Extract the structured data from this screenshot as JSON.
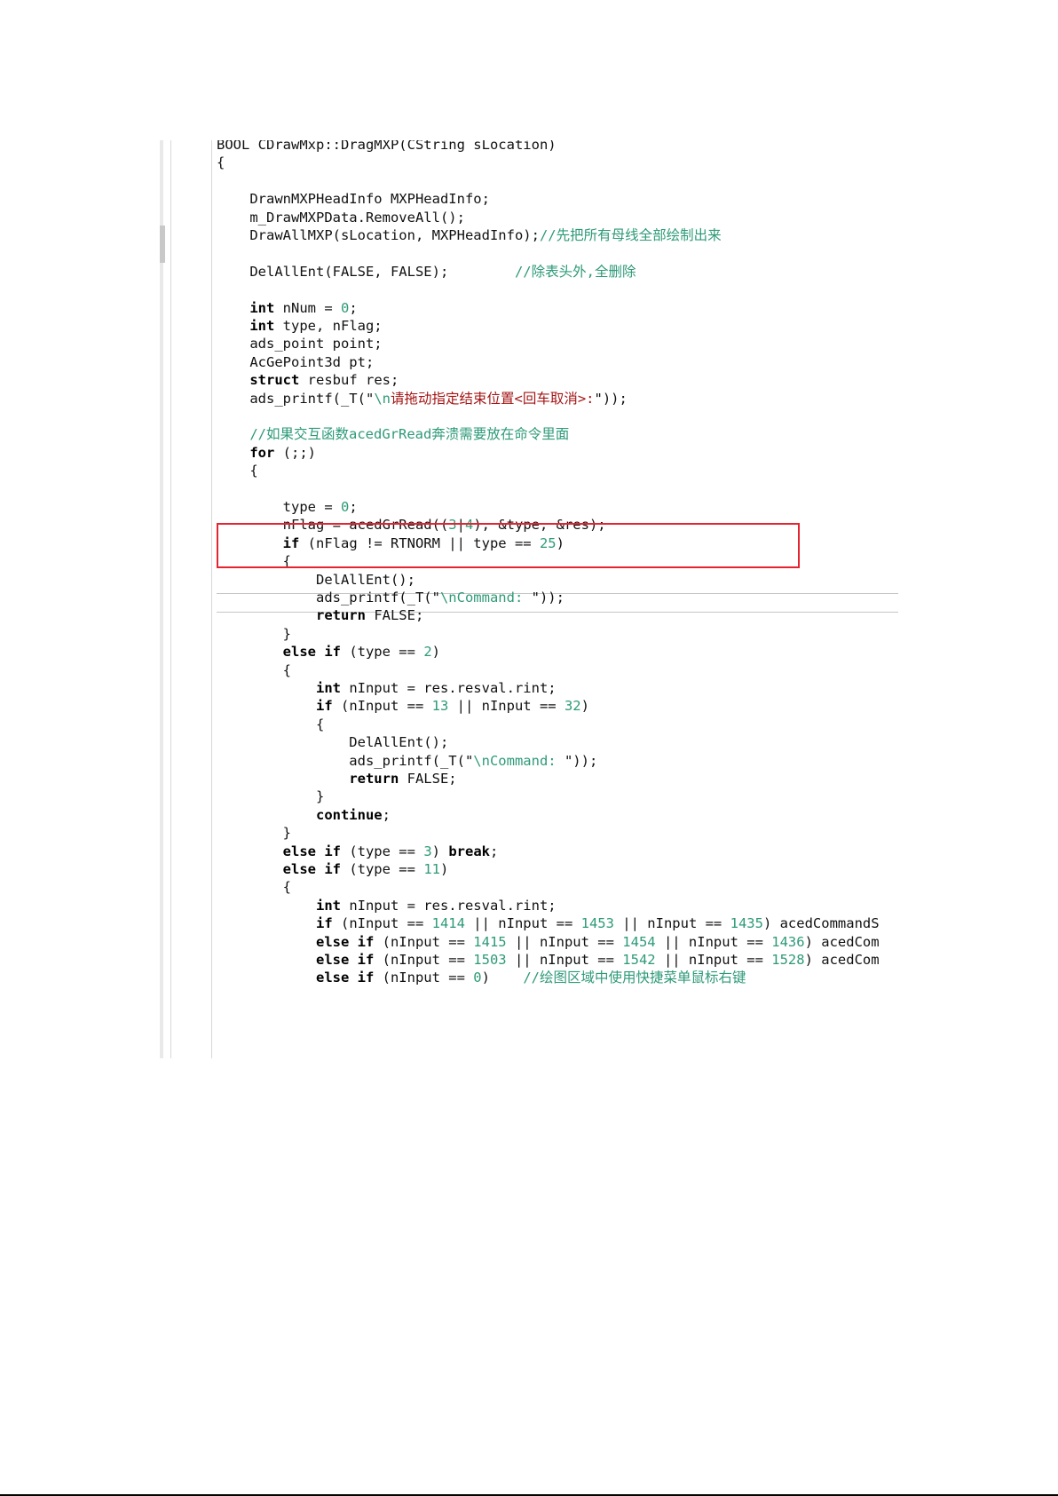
{
  "editor": {
    "lines": [
      [
        [
          "BOOL CDrawMxp::DragMXP(CString sLocation)",
          ""
        ]
      ],
      [
        [
          "{",
          ""
        ]
      ],
      [],
      [
        [
          "    DrawnMXPHeadInfo MXPHeadInfo;",
          ""
        ]
      ],
      [
        [
          "    m_DrawMXPData.RemoveAll();",
          ""
        ]
      ],
      [
        [
          "    DrawAllMXP(sLocation, MXPHeadInfo);",
          ""
        ],
        [
          "//先把所有母线全部绘制出来",
          "cmt"
        ]
      ],
      [],
      [
        [
          "    DelAllEnt(FALSE, FALSE);        ",
          ""
        ],
        [
          "//除表头外,全删除",
          "cmt"
        ]
      ],
      [],
      [
        [
          "    ",
          ""
        ],
        [
          "int",
          "kw"
        ],
        [
          " nNum = ",
          ""
        ],
        [
          "0",
          "num"
        ],
        [
          ";",
          ""
        ]
      ],
      [
        [
          "    ",
          ""
        ],
        [
          "int",
          "kw"
        ],
        [
          " type, nFlag;",
          ""
        ]
      ],
      [
        [
          "    ads_point point;",
          ""
        ]
      ],
      [
        [
          "    AcGePoint3d pt;",
          ""
        ]
      ],
      [
        [
          "    ",
          ""
        ],
        [
          "struct",
          "kw"
        ],
        [
          " resbuf res;",
          ""
        ]
      ],
      [
        [
          "    ads_printf(_T(\"",
          ""
        ],
        [
          "\\n",
          "esc"
        ],
        [
          "请拖动指定结束位置<回车取消>:",
          "str"
        ],
        [
          "\"));",
          ""
        ]
      ],
      [],
      [
        [
          "    ",
          ""
        ],
        [
          "//如果交互函数acedGrRead奔溃需要放在命令里面",
          "cmt"
        ]
      ],
      [
        [
          "    ",
          ""
        ],
        [
          "for",
          "kw"
        ],
        [
          " (;;)",
          ""
        ]
      ],
      [
        [
          "    {",
          ""
        ]
      ],
      [],
      [
        [
          "        type = ",
          ""
        ],
        [
          "0",
          "num"
        ],
        [
          ";",
          ""
        ]
      ],
      [
        [
          "        nFlag = acedGrRead((",
          ""
        ],
        [
          "3",
          "num"
        ],
        [
          "|",
          ""
        ],
        [
          "4",
          "num"
        ],
        [
          "), &type, &res);",
          ""
        ]
      ],
      [
        [
          "        ",
          ""
        ],
        [
          "if",
          "kw"
        ],
        [
          " (nFlag != RTNORM || type == ",
          ""
        ],
        [
          "25",
          "num"
        ],
        [
          ")",
          ""
        ]
      ],
      [
        [
          "        {",
          ""
        ]
      ],
      [
        [
          "            DelAllEnt();",
          ""
        ]
      ],
      [
        [
          "            ads_printf(_T(\"",
          ""
        ],
        [
          "\\nCommand: ",
          "esc"
        ],
        [
          "\"));",
          ""
        ]
      ],
      [
        [
          "            ",
          ""
        ],
        [
          "return",
          "kw"
        ],
        [
          " FALSE;",
          ""
        ]
      ],
      [
        [
          "        }",
          ""
        ]
      ],
      [
        [
          "        ",
          ""
        ],
        [
          "else if",
          "kw"
        ],
        [
          " (type == ",
          ""
        ],
        [
          "2",
          "num"
        ],
        [
          ")",
          ""
        ]
      ],
      [
        [
          "        {",
          ""
        ]
      ],
      [
        [
          "            ",
          ""
        ],
        [
          "int",
          "kw"
        ],
        [
          " nInput = res.resval.rint;",
          ""
        ]
      ],
      [
        [
          "            ",
          ""
        ],
        [
          "if",
          "kw"
        ],
        [
          " (nInput == ",
          ""
        ],
        [
          "13",
          "num"
        ],
        [
          " || nInput == ",
          ""
        ],
        [
          "32",
          "num"
        ],
        [
          ")",
          ""
        ]
      ],
      [
        [
          "            {",
          ""
        ]
      ],
      [
        [
          "                DelAllEnt();",
          ""
        ]
      ],
      [
        [
          "                ads_printf(_T(\"",
          ""
        ],
        [
          "\\nCommand: ",
          "esc"
        ],
        [
          "\"));",
          ""
        ]
      ],
      [
        [
          "                ",
          ""
        ],
        [
          "return",
          "kw"
        ],
        [
          " FALSE;",
          ""
        ]
      ],
      [
        [
          "            }",
          ""
        ]
      ],
      [
        [
          "            ",
          ""
        ],
        [
          "continue",
          "kw"
        ],
        [
          ";",
          ""
        ]
      ],
      [
        [
          "        }",
          ""
        ]
      ],
      [
        [
          "        ",
          ""
        ],
        [
          "else if",
          "kw"
        ],
        [
          " (type == ",
          ""
        ],
        [
          "3",
          "num"
        ],
        [
          ") ",
          ""
        ],
        [
          "break",
          "kw"
        ],
        [
          ";",
          ""
        ]
      ],
      [
        [
          "        ",
          ""
        ],
        [
          "else if",
          "kw"
        ],
        [
          " (type == ",
          ""
        ],
        [
          "11",
          "num"
        ],
        [
          ")",
          ""
        ]
      ],
      [
        [
          "        {",
          ""
        ]
      ],
      [
        [
          "            ",
          ""
        ],
        [
          "int",
          "kw"
        ],
        [
          " nInput = res.resval.rint;",
          ""
        ]
      ],
      [
        [
          "            ",
          ""
        ],
        [
          "if",
          "kw"
        ],
        [
          " (nInput == ",
          ""
        ],
        [
          "1414",
          "num"
        ],
        [
          " || nInput == ",
          ""
        ],
        [
          "1453",
          "num"
        ],
        [
          " || nInput == ",
          ""
        ],
        [
          "1435",
          "num"
        ],
        [
          ") acedCommandS",
          ""
        ]
      ],
      [
        [
          "            ",
          ""
        ],
        [
          "else if",
          "kw"
        ],
        [
          " (nInput == ",
          ""
        ],
        [
          "1415",
          "num"
        ],
        [
          " || nInput == ",
          ""
        ],
        [
          "1454",
          "num"
        ],
        [
          " || nInput == ",
          ""
        ],
        [
          "1436",
          "num"
        ],
        [
          ") acedCom",
          ""
        ]
      ],
      [
        [
          "            ",
          ""
        ],
        [
          "else if",
          "kw"
        ],
        [
          " (nInput == ",
          ""
        ],
        [
          "1503",
          "num"
        ],
        [
          " || nInput == ",
          ""
        ],
        [
          "1542",
          "num"
        ],
        [
          " || nInput == ",
          ""
        ],
        [
          "1528",
          "num"
        ],
        [
          ") acedCom",
          ""
        ]
      ],
      [
        [
          "            ",
          ""
        ],
        [
          "else if",
          "kw"
        ],
        [
          " (nInput == ",
          ""
        ],
        [
          "0",
          "num"
        ],
        [
          ")    ",
          ""
        ],
        [
          "//绘图区域中使用快捷菜单鼠标右键",
          "cmt"
        ]
      ]
    ]
  }
}
